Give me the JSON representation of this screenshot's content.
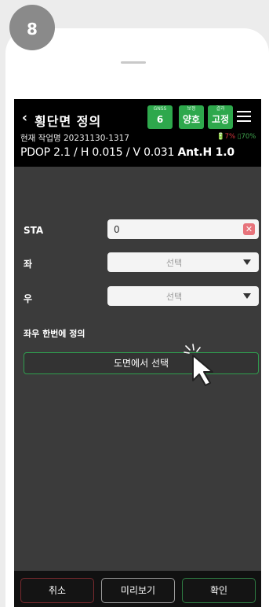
{
  "step": "8",
  "header": {
    "back_icon": "‹",
    "title": "횡단면 정의",
    "stats": [
      {
        "label": "GNSS",
        "value": "6"
      },
      {
        "label": "보정",
        "value": "양호"
      },
      {
        "label": "결과",
        "value": "고정"
      }
    ],
    "job": "현재 작업명 20231130-1317",
    "battery_device": "🔋7%",
    "battery_phone": "▯70%",
    "pdop": "PDOP 2.1 / H 0.015 / V 0.031",
    "ant_h": "Ant.H 1.0"
  },
  "form": {
    "sta_label": "STA",
    "sta_value": "0",
    "left_label": "좌",
    "left_select": "선택",
    "right_label": "우",
    "right_select": "선택"
  },
  "define_both": {
    "title": "좌우 한번에 정의",
    "button": "도면에서 선택"
  },
  "footer": {
    "cancel": "취소",
    "preview": "미리보기",
    "ok": "확인"
  },
  "colors": {
    "accent_green": "#2ea84c",
    "cancel_border": "#7a2a2e",
    "clear_red": "#e7737b"
  }
}
